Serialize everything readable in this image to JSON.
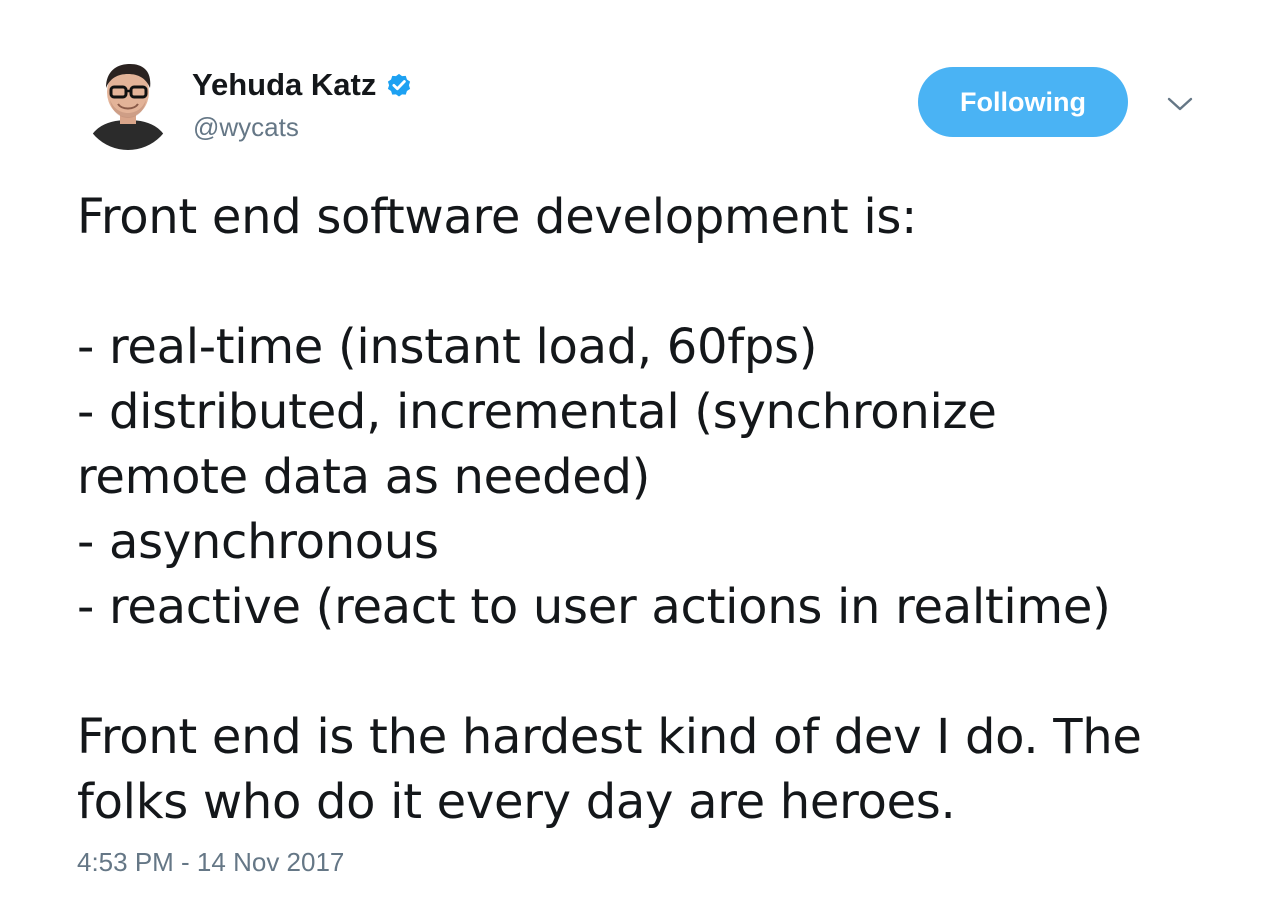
{
  "author": {
    "display_name": "Yehuda Katz",
    "handle": "@wycats",
    "verified": true,
    "avatar_icon": "user-avatar"
  },
  "actions": {
    "follow_label": "Following",
    "follow_color": "#4ab3f4",
    "menu_icon": "chevron-down-icon"
  },
  "tweet": {
    "lines": [
      "Front end software development is:",
      "",
      "- real-time (instant load, 60fps)",
      "- distributed, incremental (synchronize",
      "remote data as needed)",
      "- asynchronous",
      "- reactive (react to user actions in realtime)",
      "",
      "Front end is the hardest kind of dev I do. The",
      "folks who do it every day are heroes."
    ],
    "timestamp": "4:53 PM - 14 Nov 2017"
  },
  "colors": {
    "text": "#14171a",
    "secondary_text": "#657786",
    "verified_badge": "#1da1f2"
  }
}
